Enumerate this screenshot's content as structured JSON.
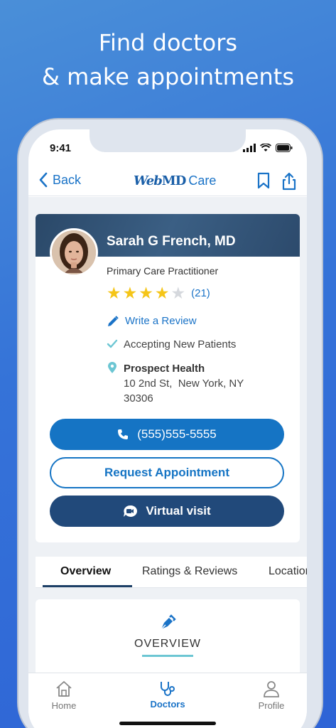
{
  "headline": {
    "line1": "Find doctors",
    "line2": "& make appointments"
  },
  "status_bar": {
    "time": "9:41"
  },
  "nav": {
    "back_label": "Back",
    "brand_web": "Web",
    "brand_md": "MD",
    "brand_care": "Care"
  },
  "doctor": {
    "name": "Sarah G French, MD",
    "specialty": "Primary Care Practitioner",
    "rating": 4,
    "rating_max": 5,
    "rating_count": "(21)",
    "write_review_label": "Write a Review",
    "accepting_label": "Accepting New Patients",
    "location_name": "Prospect Health",
    "address_line1": "10 2nd St,  New York, NY",
    "address_line2": "30306"
  },
  "actions": {
    "phone_label": "(555)555-5555",
    "request_label": "Request Appointment",
    "virtual_label": "Virtual visit"
  },
  "tabs": [
    {
      "label": "Overview"
    },
    {
      "label": "Ratings & Reviews"
    },
    {
      "label": "Locations"
    }
  ],
  "overview": {
    "title": "OVERVIEW"
  },
  "tabbar": [
    {
      "label": "Home"
    },
    {
      "label": "Doctors"
    },
    {
      "label": "Profile"
    }
  ],
  "colors": {
    "primary": "#1574c4",
    "navy": "#21497a",
    "star": "#f5c518",
    "accent_teal": "#6cc6d3"
  }
}
